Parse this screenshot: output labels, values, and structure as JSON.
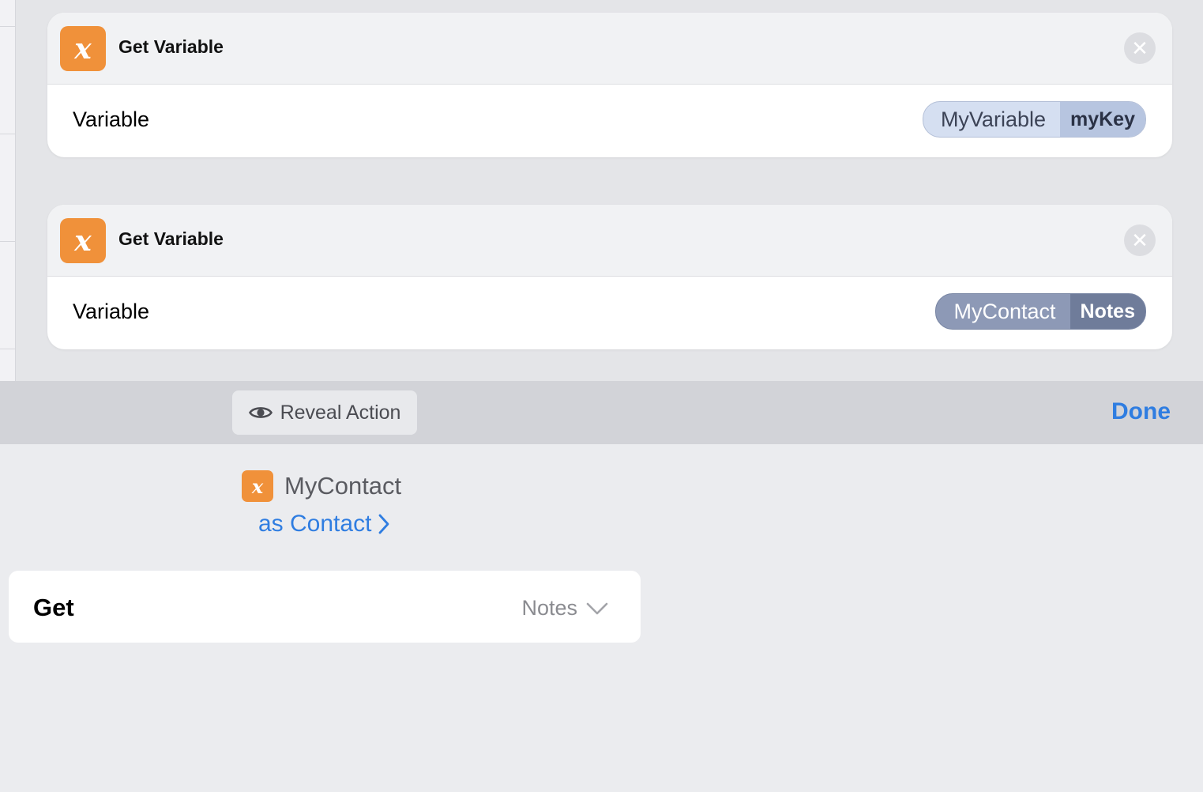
{
  "actions": [
    {
      "icon": "variable-x-icon",
      "icon_glyph": "x",
      "title": "Get Variable",
      "row_label": "Variable",
      "token_main": "MyVariable",
      "token_sub": "myKey"
    },
    {
      "icon": "variable-x-icon",
      "icon_glyph": "x",
      "title": "Get Variable",
      "row_label": "Variable",
      "token_main": "MyContact",
      "token_sub": "Notes"
    }
  ],
  "toolbar": {
    "reveal_label": "Reveal Action",
    "done_label": "Done"
  },
  "panel": {
    "variable_icon_glyph": "x",
    "variable_name": "MyContact",
    "type_link": "as Contact",
    "get_label": "Get",
    "get_value": "Notes"
  },
  "colors": {
    "accent_blue": "#2f7de1",
    "icon_orange": "#f0913a"
  }
}
